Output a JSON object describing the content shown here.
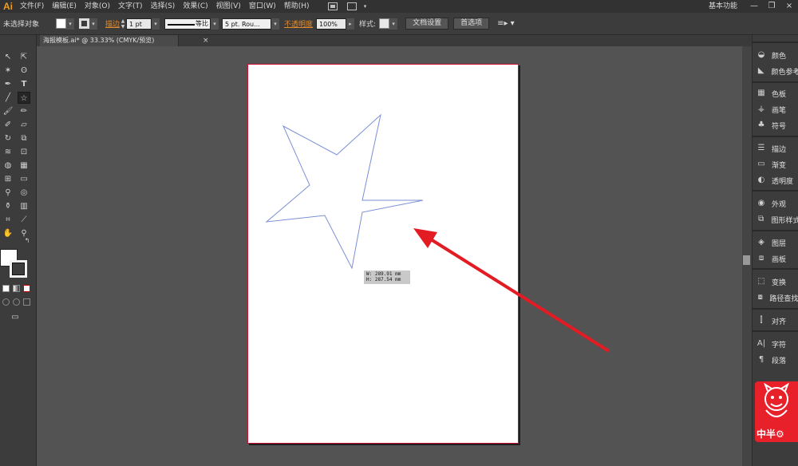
{
  "app": {
    "logo": "Ai",
    "workspace": "基本功能"
  },
  "menu": [
    "文件(F)",
    "编辑(E)",
    "对象(O)",
    "文字(T)",
    "选择(S)",
    "效果(C)",
    "视图(V)",
    "窗口(W)",
    "帮助(H)"
  ],
  "control_bar": {
    "selection_status": "未选择对象",
    "stroke_label": "描边",
    "stroke_weight": "1 pt",
    "stroke_profile": "等比",
    "brush": "5 pt. Rou...",
    "opacity_label": "不透明度",
    "opacity_value": "100%",
    "style_label": "样式:",
    "document_setup_button": "文档设置",
    "preferences_button": "首选项"
  },
  "document_tab": {
    "title": "海报模板.ai* @ 33.33% (CMYK/预览)",
    "close": "×"
  },
  "window_controls": {
    "minimize": "—",
    "restore": "❐",
    "close": "×"
  },
  "measure": {
    "width": "W: 289.91 mm",
    "height": "H: 287.54 mm"
  },
  "right_panels": [
    {
      "icon": "color-icon",
      "label": "颜色"
    },
    {
      "icon": "color-guide-icon",
      "label": "颜色参考"
    },
    {
      "icon": "swatches-icon",
      "label": "色板"
    },
    {
      "icon": "brushes-icon",
      "label": "画笔"
    },
    {
      "icon": "symbols-icon",
      "label": "符号"
    },
    {
      "icon": "stroke-icon",
      "label": "描边"
    },
    {
      "icon": "gradient-icon",
      "label": "渐变"
    },
    {
      "icon": "transparency-icon",
      "label": "透明度"
    },
    {
      "icon": "appearance-icon",
      "label": "外观"
    },
    {
      "icon": "graphic-styles-icon",
      "label": "图形样式"
    },
    {
      "icon": "layers-icon",
      "label": "图层"
    },
    {
      "icon": "artboards-icon",
      "label": "画板"
    },
    {
      "icon": "transform-icon",
      "label": "变换"
    },
    {
      "icon": "pathfinder-icon",
      "label": "路径查找器"
    },
    {
      "icon": "align-icon",
      "label": "对齐"
    },
    {
      "icon": "character-icon",
      "label": "字符"
    },
    {
      "icon": "paragraph-icon",
      "label": "段落"
    }
  ],
  "watermark": {
    "text": "中半⚙"
  },
  "colors": {
    "accent_orange": "#e38a2a",
    "artboard_border": "#c8102e",
    "star_stroke": "#7a8fd6",
    "arrow": "#e31b23"
  }
}
